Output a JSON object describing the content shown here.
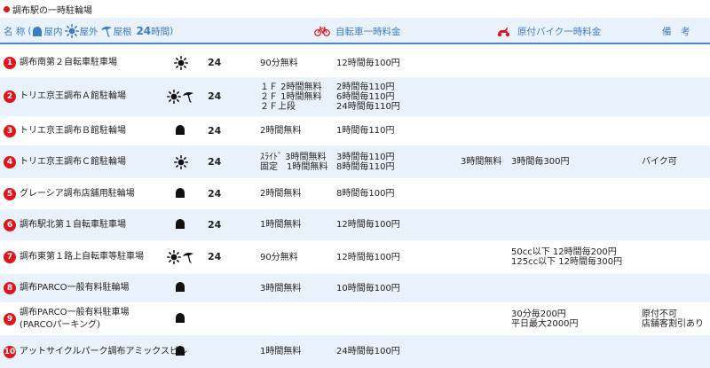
{
  "title": "調布駅の一時駐輪場",
  "header": {
    "name": "名 称",
    "open_paren": "(",
    "indoor": "屋内",
    "outdoor": "屋外",
    "roof": "屋根",
    "hours24": "24",
    "hours24_suffix": "時間",
    "close_paren": ")",
    "bicycle_fee": "自転車一時料金",
    "moped_fee": "原付バイク一時料金",
    "notes": "備　考"
  },
  "colors": {
    "accent": "#3d7cc2",
    "badge": "#e0141b",
    "row_alt": "#e9f2fa"
  },
  "rows": [
    {
      "num": "1",
      "name": [
        "調布南第２自転車駐車場"
      ],
      "icons": [
        "sun-icon"
      ],
      "h24": "24",
      "bike_free": [
        "90分無料"
      ],
      "bike_fee": [
        "12時間毎100円"
      ],
      "moped_free": [],
      "moped_fee": [],
      "notes": []
    },
    {
      "num": "2",
      "name": [
        "トリエ京王調布Ａ館駐輪場"
      ],
      "icons": [
        "sun-icon",
        "umbrella-icon"
      ],
      "h24": "24",
      "bike_free": [
        "１Ｆ 2時間無料",
        "２Ｆ 1時間無料",
        "２Ｆ上段"
      ],
      "bike_fee": [
        "2時間毎110円",
        "6時間毎110円",
        "24時間毎110円"
      ],
      "moped_free": [],
      "moped_fee": [],
      "notes": []
    },
    {
      "num": "3",
      "name": [
        "トリエ京王調布Ｂ館駐輪場"
      ],
      "icons": [
        "indoor-icon"
      ],
      "h24": "24",
      "bike_free": [
        "2時間無料"
      ],
      "bike_fee": [
        "1時間毎110円"
      ],
      "moped_free": [],
      "moped_fee": [],
      "notes": []
    },
    {
      "num": "4",
      "name": [
        "トリエ京王調布Ｃ館駐輪場"
      ],
      "icons": [
        "sun-icon"
      ],
      "h24": "24",
      "bike_free": [
        "ｽﾗｲﾄﾞ 3時間無料",
        "固定　1時間無料"
      ],
      "bike_fee": [
        "3時間毎110円",
        "8時間毎110円"
      ],
      "moped_free": [
        "3時間無料"
      ],
      "moped_fee": [
        "3時間毎300円"
      ],
      "notes": [
        "バイク可"
      ]
    },
    {
      "num": "5",
      "name": [
        "グレーシア調布店舗用駐輪場"
      ],
      "icons": [
        "indoor-icon"
      ],
      "h24": "24",
      "bike_free": [
        "2時間無料"
      ],
      "bike_fee": [
        "8時間毎100円"
      ],
      "moped_free": [],
      "moped_fee": [],
      "notes": []
    },
    {
      "num": "6",
      "name": [
        "調布駅北第１自転車駐車場"
      ],
      "icons": [
        "indoor-icon"
      ],
      "h24": "24",
      "bike_free": [
        "1時間無料"
      ],
      "bike_fee": [
        "12時間毎100円"
      ],
      "moped_free": [],
      "moped_fee": [],
      "notes": []
    },
    {
      "num": "7",
      "name": [
        "調布東第１路上自転車等駐車場"
      ],
      "icons": [
        "sun-icon",
        "umbrella-icon"
      ],
      "h24": "24",
      "bike_free": [
        "90分無料"
      ],
      "bike_fee": [
        "12時間毎100円"
      ],
      "moped_free": [],
      "moped_fee": [
        "50cc以下 12時間毎200円",
        "125cc以下 12時間毎300円"
      ],
      "notes": []
    },
    {
      "num": "8",
      "name": [
        "調布PARCO一般有料駐輪場"
      ],
      "icons": [
        "indoor-icon"
      ],
      "h24": "",
      "bike_free": [
        "3時間無料"
      ],
      "bike_fee": [
        "10時間毎100円"
      ],
      "moped_free": [],
      "moped_fee": [],
      "notes": []
    },
    {
      "num": "9",
      "name": [
        "調布PARCO一般有料駐車場",
        "(PARCOパーキング)"
      ],
      "icons": [
        "indoor-icon"
      ],
      "h24": "",
      "bike_free": [],
      "bike_fee": [],
      "moped_free": [],
      "moped_fee": [
        "30分毎200円",
        "平日最大2000円"
      ],
      "notes": [
        "原付不可",
        "店舗客割引あり"
      ]
    },
    {
      "num": "10",
      "name": [
        "アットサイクルパーク調布アミックスビル"
      ],
      "icons": [
        "indoor-icon"
      ],
      "h24": "",
      "bike_free": [
        "1時間無料"
      ],
      "bike_fee": [
        "24時間毎100円"
      ],
      "moped_free": [],
      "moped_fee": [],
      "notes": []
    }
  ]
}
